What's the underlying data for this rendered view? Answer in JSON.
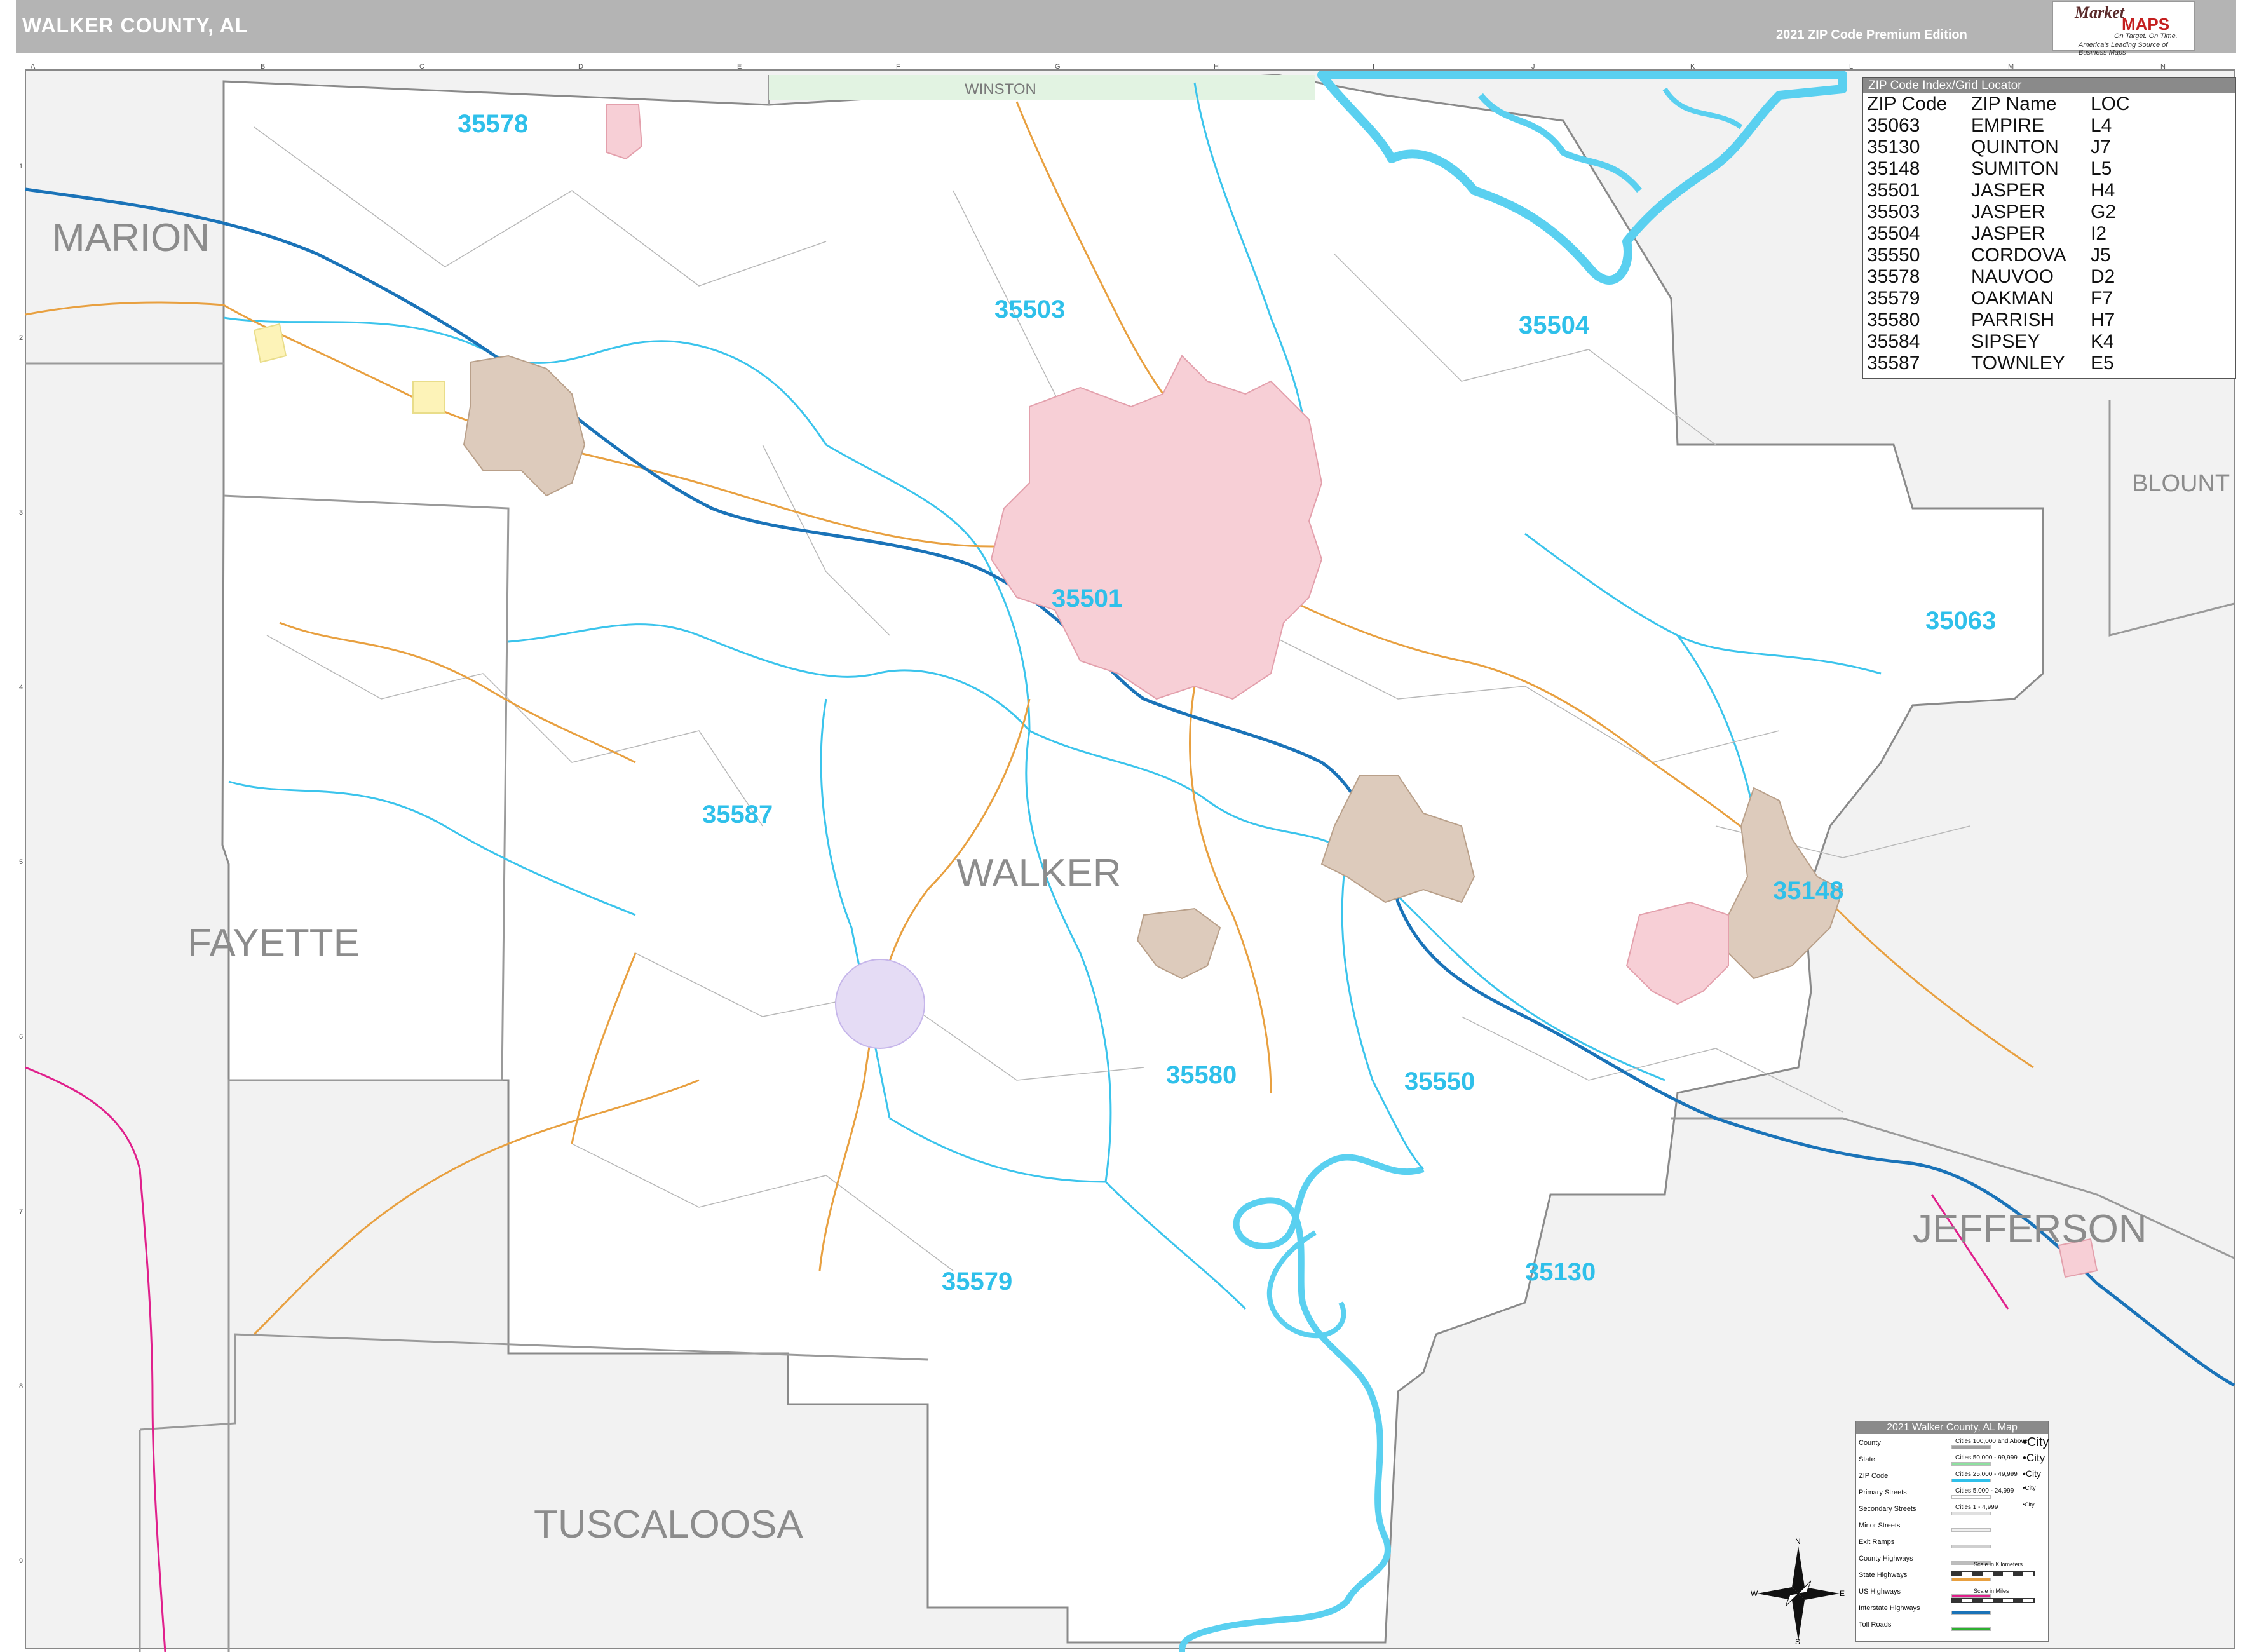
{
  "header": {
    "title": "WALKER COUNTY, AL",
    "edition": "2021 ZIP Code Premium Edition"
  },
  "logo": {
    "word1": "Market",
    "word2": "MAPS",
    "tagline1": "On Target. On Time.",
    "tagline2": "America's Leading Source of Business Maps"
  },
  "grid": {
    "columns": [
      "A",
      "B",
      "C",
      "D",
      "E",
      "F",
      "G",
      "H",
      "I",
      "J",
      "K",
      "L",
      "M",
      "N"
    ],
    "rows": [
      "1",
      "2",
      "3",
      "4",
      "5",
      "6",
      "7",
      "8",
      "9"
    ]
  },
  "counties": {
    "center": "WALKER",
    "marion": "MARION",
    "fayette": "FAYETTE",
    "tuscaloosa": "TUSCALOOSA",
    "jefferson": "JEFFERSON",
    "blount": "BLOUNT",
    "winston": "WINSTON"
  },
  "zip_labels": [
    "35578",
    "35503",
    "35504",
    "35501",
    "35063",
    "35587",
    "35148",
    "35580",
    "35550",
    "35579",
    "35130"
  ],
  "zip_index": {
    "title": "ZIP Code Index/Grid Locator",
    "headers": [
      "ZIP Code",
      "ZIP Name",
      "LOC"
    ],
    "rows": [
      [
        "35063",
        "EMPIRE",
        "L4"
      ],
      [
        "35130",
        "QUINTON",
        "J7"
      ],
      [
        "35148",
        "SUMITON",
        "L5"
      ],
      [
        "35501",
        "JASPER",
        "H4"
      ],
      [
        "35503",
        "JASPER",
        "G2"
      ],
      [
        "35504",
        "JASPER",
        "I2"
      ],
      [
        "35550",
        "CORDOVA",
        "J5"
      ],
      [
        "35578",
        "NAUVOO",
        "D2"
      ],
      [
        "35579",
        "OAKMAN",
        "F7"
      ],
      [
        "35580",
        "PARRISH",
        "H7"
      ],
      [
        "35584",
        "SIPSEY",
        "K4"
      ],
      [
        "35587",
        "TOWNLEY",
        "E5"
      ]
    ]
  },
  "legend": {
    "title": "2021 Walker County, AL Map",
    "items": [
      "County",
      "State",
      "ZIP Code",
      "Primary Streets",
      "Secondary Streets",
      "Minor Streets",
      "Exit Ramps",
      "County Highways",
      "State Highways",
      "US Highways",
      "Interstate Highways",
      "Toll Roads"
    ],
    "cities": [
      {
        "label": "Cities 100,000 and Above",
        "sample": "•City"
      },
      {
        "label": "Cities 50,000 - 99,999",
        "sample": "•City"
      },
      {
        "label": "Cities 25,000 - 49,999",
        "sample": "•City"
      },
      {
        "label": "Cities 5,000 - 24,999",
        "sample": "•City"
      },
      {
        "label": "Cities 1 - 4,999",
        "sample": "•City"
      }
    ],
    "scale_km": "Scale in Kilometers",
    "scale_mi": "Scale in Miles",
    "colors": {
      "county": "#a0a0a0",
      "state": "#8ee0a0",
      "zip": "#2fc0ea",
      "county_hwy": "#bdbdbd",
      "state_hwy": "#e8a040",
      "us_hwy": "#e0208c",
      "interstate": "#1a73b8",
      "toll": "#2db030"
    }
  },
  "compass": {
    "n": "N",
    "s": "S",
    "e": "E",
    "w": "W"
  }
}
